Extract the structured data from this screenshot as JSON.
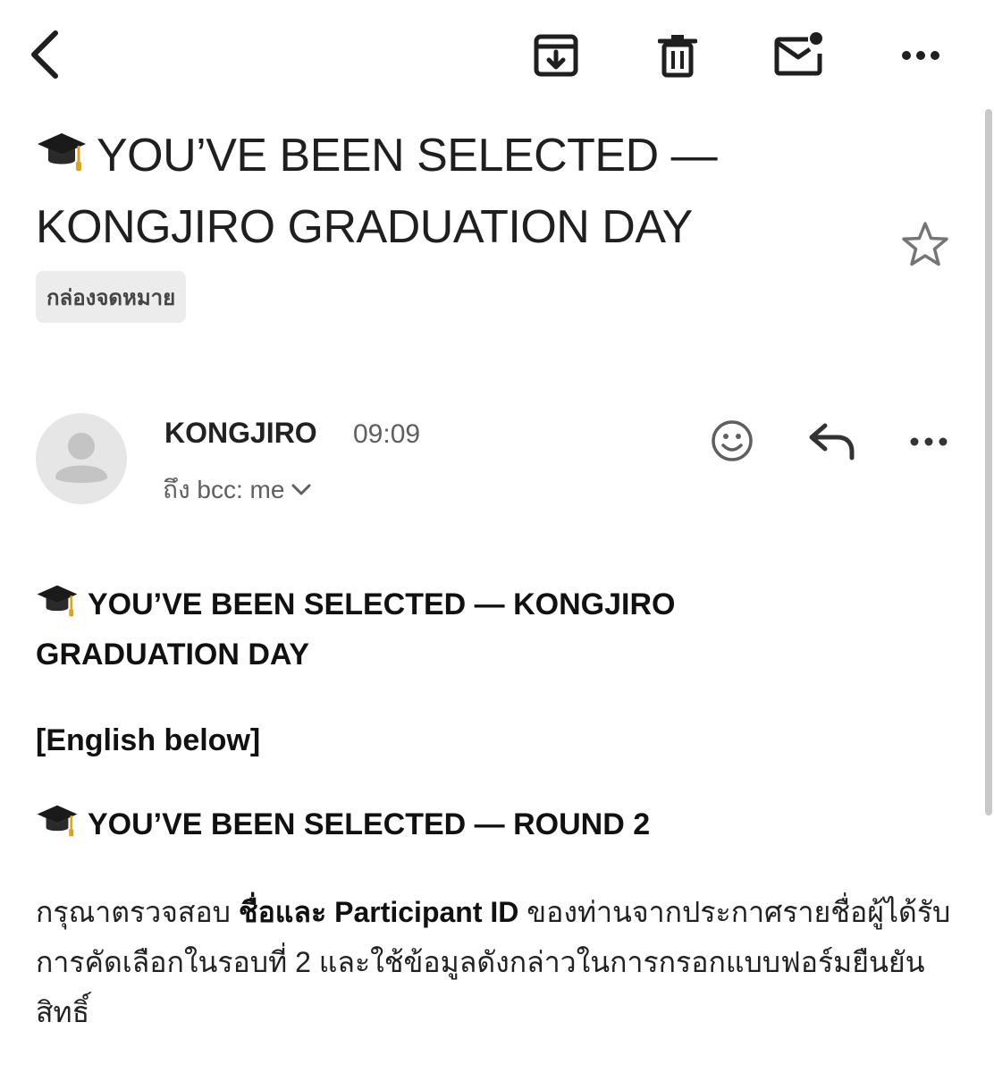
{
  "toolbar": {
    "back_icon": "chevron-left-icon",
    "archive_icon": "archive-icon",
    "delete_icon": "trash-icon",
    "mark_unread_icon": "mail-unread-icon",
    "more_icon": "more-horizontal-icon"
  },
  "email": {
    "subject": "YOU’VE BEEN SELECTED — KONGJIRO GRADUATION DAY",
    "label": "กล่องจดหมาย",
    "sender": "KONGJIRO",
    "time": "09:09",
    "recipients": "ถึง bcc: me"
  },
  "body": {
    "heading": "YOU’VE BEEN SELECTED — KONGJIRO GRADUATION DAY",
    "english_note": "[English below]",
    "round_heading": "YOU’VE BEEN SELECTED — ROUND 2",
    "paragraph": {
      "part1": "กรุณาตรวจสอบ ",
      "bold": "ชื่อและ Participant ID",
      "part2": " ของท่านจากประกาศรายชื่อผู้ได้รับการคัดเลือกในรอบที่ 2 และใช้ข้อมูลดังกล่าวในการกรอกแบบฟอร์มยืนยันสิทธิ์"
    }
  },
  "colors": {
    "chip_bg": "#ececec",
    "icon": "#1f1f1f",
    "muted": "#5f5f5f",
    "scrollbar": "#c9c9c9"
  }
}
